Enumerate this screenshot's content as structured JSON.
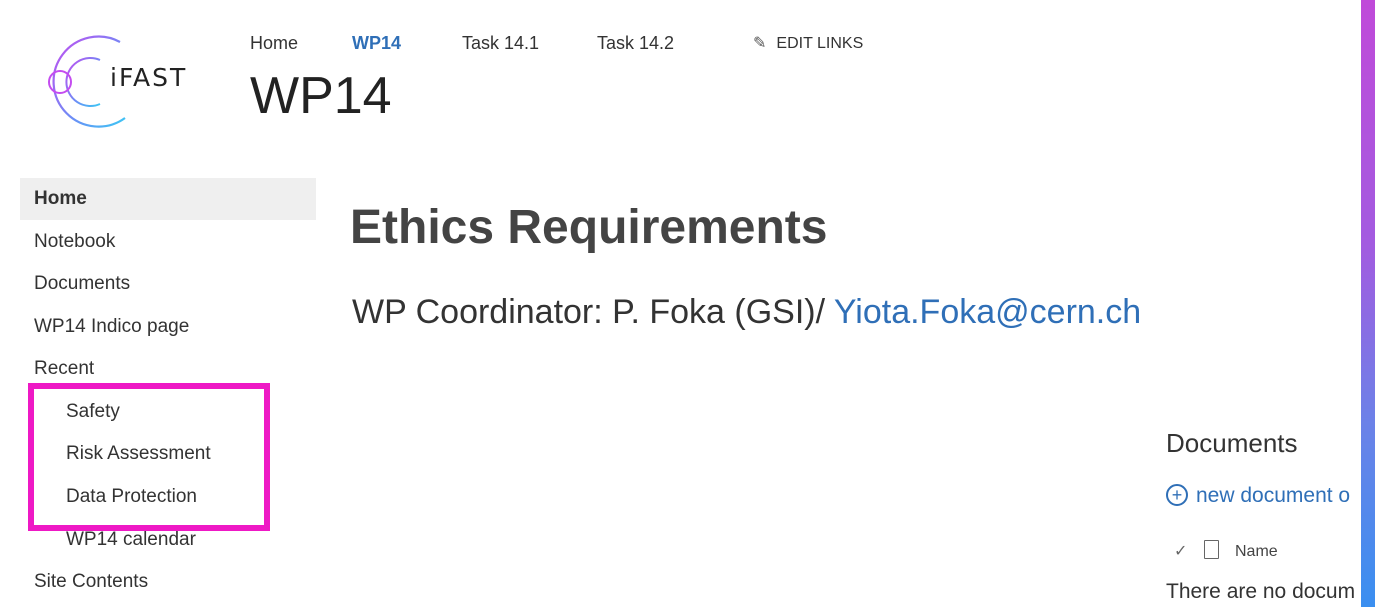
{
  "logo": {
    "text": "iFAST",
    "colors": [
      "#c44cf0",
      "#6a8ff6",
      "#3cc7f4"
    ]
  },
  "topnav": {
    "items": [
      {
        "label": "Home",
        "active": false
      },
      {
        "label": "WP14",
        "active": true
      },
      {
        "label": "Task 14.1",
        "active": false
      },
      {
        "label": "Task 14.2",
        "active": false
      }
    ],
    "edit_links_label": "EDIT LINKS",
    "edit_icon": "pencil-icon"
  },
  "site_title": "WP14",
  "leftnav": {
    "items": [
      {
        "label": "Home",
        "selected": true
      },
      {
        "label": "Notebook"
      },
      {
        "label": "Documents"
      },
      {
        "label": "WP14 Indico page"
      },
      {
        "label": "Recent"
      },
      {
        "label": "Safety",
        "sub": true
      },
      {
        "label": "Risk Assessment",
        "sub": true
      },
      {
        "label": "Data Protection",
        "sub": true
      },
      {
        "label": "WP14 calendar",
        "sub": true
      },
      {
        "label": "Site Contents"
      }
    ],
    "highlight_color": "#ee19c5"
  },
  "main": {
    "heading": "Ethics Requirements",
    "coordinator_prefix": "WP Coordinator: P. Foka (GSI)/ ",
    "coordinator_email": "Yiota.Foka@cern.ch"
  },
  "documents": {
    "title": "Documents",
    "new_document_label": "new document o",
    "column_name": "Name",
    "empty_text": "There are no docum"
  },
  "colors": {
    "link": "#2f6fb7",
    "accent": "#ee19c5"
  }
}
